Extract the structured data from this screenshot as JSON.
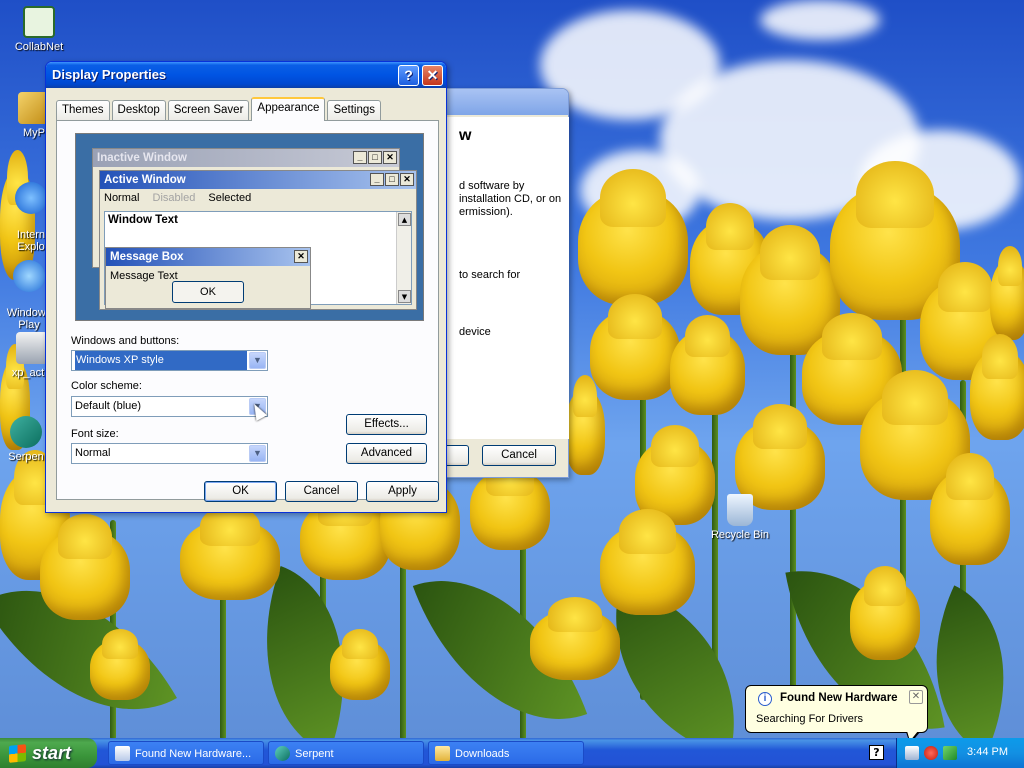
{
  "desktop_icons": [
    {
      "label": "CollabNet",
      "icon": "collabnet-icon"
    },
    {
      "label": "MyP",
      "icon": "my-pictures-icon"
    },
    {
      "label": "Intern\nExplo",
      "icon": "internet-explorer-icon"
    },
    {
      "label": "Windows\nPlay",
      "icon": "windows-media-player-icon"
    },
    {
      "label": "xp_activ",
      "icon": "xp-activate-icon"
    },
    {
      "label": "Serpen",
      "icon": "serpent-icon"
    },
    {
      "label": "Recycle Bin",
      "icon": "recycle-bin-icon"
    }
  ],
  "wizard": {
    "heading": "w",
    "lines": [
      "d software by",
      "installation CD, or on",
      "ermission).",
      "to search for",
      "device"
    ],
    "cancel_label": "Cancel"
  },
  "display_properties": {
    "title": "Display Properties",
    "tabs": [
      "Themes",
      "Desktop",
      "Screen Saver",
      "Appearance",
      "Settings"
    ],
    "active_tab": "Appearance",
    "preview": {
      "inactive_title": "Inactive Window",
      "active_title": "Active Window",
      "menu": [
        "Normal",
        "Disabled",
        "Selected"
      ],
      "window_text": "Window Text",
      "msgbox_title": "Message Box",
      "msgbox_text": "Message Text",
      "ok_label": "OK"
    },
    "windows_buttons_label": "Windows and buttons:",
    "windows_buttons_value": "Windows XP style",
    "color_scheme_label": "Color scheme:",
    "color_scheme_value": "Default (blue)",
    "font_size_label": "Font size:",
    "font_size_value": "Normal",
    "effects_label": "Effects...",
    "advanced_label": "Advanced",
    "ok_label": "OK",
    "cancel_label": "Cancel",
    "apply_label": "Apply"
  },
  "balloon": {
    "title": "Found New Hardware",
    "body": "Searching For Drivers"
  },
  "taskbar": {
    "start_label": "start",
    "tasks": [
      {
        "label": "Found New Hardware...",
        "icon": "hardware-icon"
      },
      {
        "label": "Serpent",
        "icon": "serpent-icon"
      },
      {
        "label": "Downloads",
        "icon": "folder-icon"
      }
    ],
    "clock": "3:44 PM"
  },
  "colors": {
    "xp_blue": "#0054e3",
    "taskbar_blue": "#2352d6",
    "start_green": "#3a953a",
    "tray_blue": "#1290e3"
  }
}
